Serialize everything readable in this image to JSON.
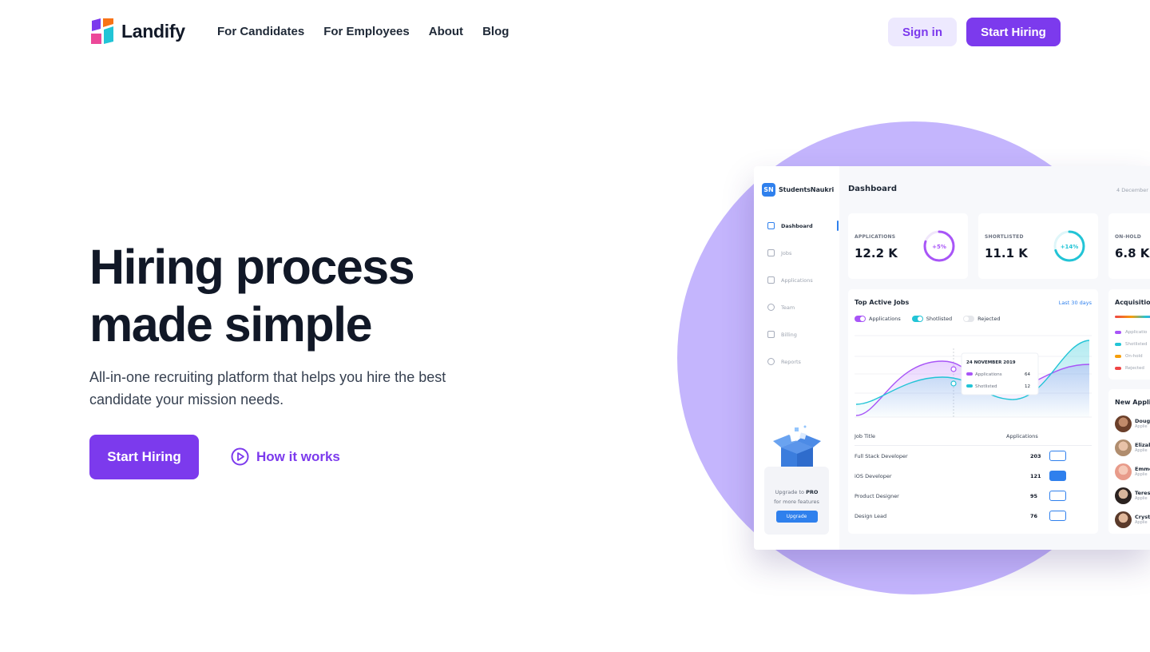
{
  "brand": {
    "name": "Landify"
  },
  "nav": {
    "links": [
      "For Candidates",
      "For Employees",
      "About",
      "Blog"
    ],
    "signin": "Sign in",
    "start_hiring": "Start Hiring"
  },
  "hero": {
    "title_line1": "Hiring process",
    "title_line2": "made simple",
    "subtitle": "All-in-one recruiting platform that helps you hire the best candidate your mission needs.",
    "cta": "Start Hiring",
    "how": "How it works"
  },
  "colors": {
    "accent": "#7c3aed",
    "accent_light": "#ede9fe",
    "circle": "#c4b5fd",
    "dash_blue": "#2f80ed",
    "purple_series": "#a855f7",
    "cyan_series": "#22c4d6"
  },
  "dashboard": {
    "brand_badge": "SN",
    "brand_name": "StudentsNaukri",
    "title": "Dashboard",
    "date": "4 December",
    "sidebar": [
      "Dashboard",
      "Jobs",
      "Applications",
      "Team",
      "Billing",
      "Reports"
    ],
    "upgrade": {
      "line1_a": "Upgrade to ",
      "line1_b": "PRO",
      "line2": "for more features",
      "button": "Upgrade"
    },
    "stats": [
      {
        "label": "APPLICATIONS",
        "value": "12.2 K",
        "badge": "+5%",
        "progress": 0.8,
        "color": "#a855f7"
      },
      {
        "label": "SHORTLISTED",
        "value": "11.1 K",
        "badge": "+14%",
        "progress": 0.7,
        "color": "#22c4d6"
      },
      {
        "label": "ON-HOLD",
        "value": "6.8 K"
      }
    ],
    "top_jobs": {
      "title": "Top Active Jobs",
      "range": "Last 30 days",
      "legend": [
        "Applications",
        "Shotlisted",
        "Rejected"
      ],
      "tooltip": {
        "date": "24 NOVEMBER 2019",
        "rows": [
          {
            "label": "Applications",
            "value": "64"
          },
          {
            "label": "Shotlisted",
            "value": "12"
          }
        ]
      },
      "col_job": "Job Title",
      "col_apps": "Applications",
      "rows": [
        {
          "title": "Full Stack Developer",
          "count": "203"
        },
        {
          "title": "iOS Developer",
          "count": "121"
        },
        {
          "title": "Product Designer",
          "count": "95"
        },
        {
          "title": "Design Lead",
          "count": "76"
        }
      ]
    },
    "acquisition": {
      "title": "Acquisitio",
      "items": [
        "Applicatio",
        "Shotlisted",
        "On-hold",
        "Rejected"
      ]
    },
    "new_applicants": {
      "title": "New Appli",
      "people": [
        {
          "name": "Doug",
          "role": "Applie"
        },
        {
          "name": "Elizab",
          "role": "Applie"
        },
        {
          "name": "Emme",
          "role": "Applie"
        },
        {
          "name": "Teres",
          "role": "Applie"
        },
        {
          "name": "Cryst",
          "role": "Applie"
        }
      ]
    }
  }
}
